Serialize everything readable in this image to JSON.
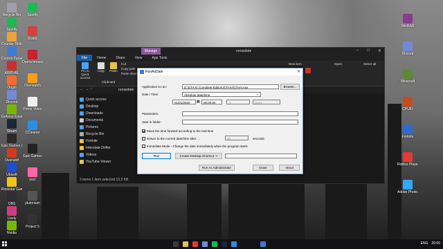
{
  "desktop_icons": [
    {
      "label": "Recycle Bin",
      "color": "#9aa0a6"
    },
    {
      "label": "Spotify",
      "color": "#1db954"
    },
    {
      "label": "Counter-Strike Global Off...",
      "color": "#e8a33d"
    },
    {
      "label": "Control Panel",
      "color": "#3d7bd8"
    },
    {
      "label": "ARRIVAL",
      "color": "#c9302c"
    },
    {
      "label": "Origin",
      "color": "#f56c2d"
    },
    {
      "label": "Discord",
      "color": "#7289da"
    },
    {
      "label": "Geforce Experience",
      "color": "#76b900"
    },
    {
      "label": "Steam",
      "color": "#1b2838"
    },
    {
      "label": "Epic Games Launcher",
      "color": "#2a2a2a"
    },
    {
      "label": "Overwolf",
      "color": "#d13b1f"
    },
    {
      "label": "Ubisoft",
      "color": "#1e4ed8"
    },
    {
      "label": "Rockstar Games",
      "color": "#f0c419"
    },
    {
      "label": "OBS",
      "color": "#302e31"
    },
    {
      "label": "Lively",
      "color": "#d13b7f"
    },
    {
      "label": "Nvidia",
      "color": "#76b900"
    }
  ],
  "desktop_icons_col2": [
    {
      "label": "Spotify",
      "color": "#1db954"
    },
    {
      "label": "Sciatic",
      "color": "#d84040"
    },
    {
      "label": "Opera browser",
      "color": "#cc1f2f"
    },
    {
      "label": "Overwatch",
      "color": "#f99e1a"
    },
    {
      "label": "Prime Video",
      "color": "#f0f0f0"
    },
    {
      "label": "CCleaner",
      "color": "#2a8ee0"
    },
    {
      "label": "Epic Games",
      "color": "#222222"
    },
    {
      "label": "osu!",
      "color": "#ff66aa"
    },
    {
      "label": "plutonium",
      "color": "#555555"
    },
    {
      "label": "Project 5",
      "color": "#333333"
    }
  ],
  "desktop_icons_right": [
    {
      "label": "WinRAR",
      "color": "#8b3b8b"
    },
    {
      "label": "Discord",
      "color": "#7289da"
    },
    {
      "label": "Minecraft",
      "color": "#5b8c32"
    },
    {
      "label": "CPUID",
      "color": "#c94a1f"
    },
    {
      "label": "Fortnite",
      "color": "#2d6bd4"
    },
    {
      "label": "Roblox Player",
      "color": "#e53935"
    },
    {
      "label": "Adobe Photo...",
      "color": "#31a8ff"
    }
  ],
  "explorer": {
    "title": "runasdate",
    "manage_tab": "Manage",
    "app_tools_tab": "App Tools",
    "tabs": [
      "File",
      "Home",
      "Share",
      "View"
    ],
    "ribbon": {
      "pin": "Pin to Quick access",
      "copy": "Copy",
      "paste": "Paste",
      "cut": "Cut",
      "copy_path": "Copy path",
      "paste_shortcut": "Paste shortcut",
      "clipboard": "Clipboard",
      "new_item": "New item",
      "open": "Open",
      "select_all": "Select all"
    },
    "address": "runasdate",
    "nav": [
      {
        "label": "Quick access",
        "color": "#4aa3f0"
      },
      {
        "label": "Desktop",
        "color": "#4aa3f0"
      },
      {
        "label": "Downloads",
        "color": "#4aa3f0"
      },
      {
        "label": "Documents",
        "color": "#cccccc"
      },
      {
        "label": "Pictures",
        "color": "#4aa3f0"
      },
      {
        "label": "Recycle Bin",
        "color": "#aaaaaa"
      },
      {
        "label": "Fortnite",
        "color": "#e8c14a"
      },
      {
        "label": "Interstate Drifter",
        "color": "#e8c14a"
      },
      {
        "label": "Videos",
        "color": "#4aa3f0"
      },
      {
        "label": "YouTube-Viewer",
        "color": "#e8c14a"
      }
    ],
    "status": "3 items   1 item selected  13.2 KB"
  },
  "dialog": {
    "title": "RunAsDate",
    "app_label": "Application to run:",
    "app_value": "D:\\GTA IV Complete Edition\\GTAIV\\GTAIV.exe",
    "browse": "Browse...",
    "datetime_label": "Date / Time:",
    "datetime_mode": "Absolute date/time",
    "date_value": "01/01/2020",
    "time_value": "00:00:00",
    "days_value": "-1",
    "days_unit": "Days",
    "params_label": "Parameters:",
    "params_value": "",
    "startin_label": "Start in folder:",
    "startin_value": "",
    "chk_move": "Move the time forward according to the real time",
    "chk_return": "Return to the current date/time after.....",
    "return_seconds": "30",
    "seconds_label": "seconds",
    "chk_immediate": "Immediate Mode - Change the date immediately when the program starts",
    "run": "Run",
    "create_shortcut": "Create Desktop Shortcut ->",
    "shortcut_name": "",
    "run_admin": "Run As Administrator",
    "close": "Close",
    "about": "About"
  },
  "taskbar": {
    "lang": "ENG",
    "time": "20:05"
  }
}
